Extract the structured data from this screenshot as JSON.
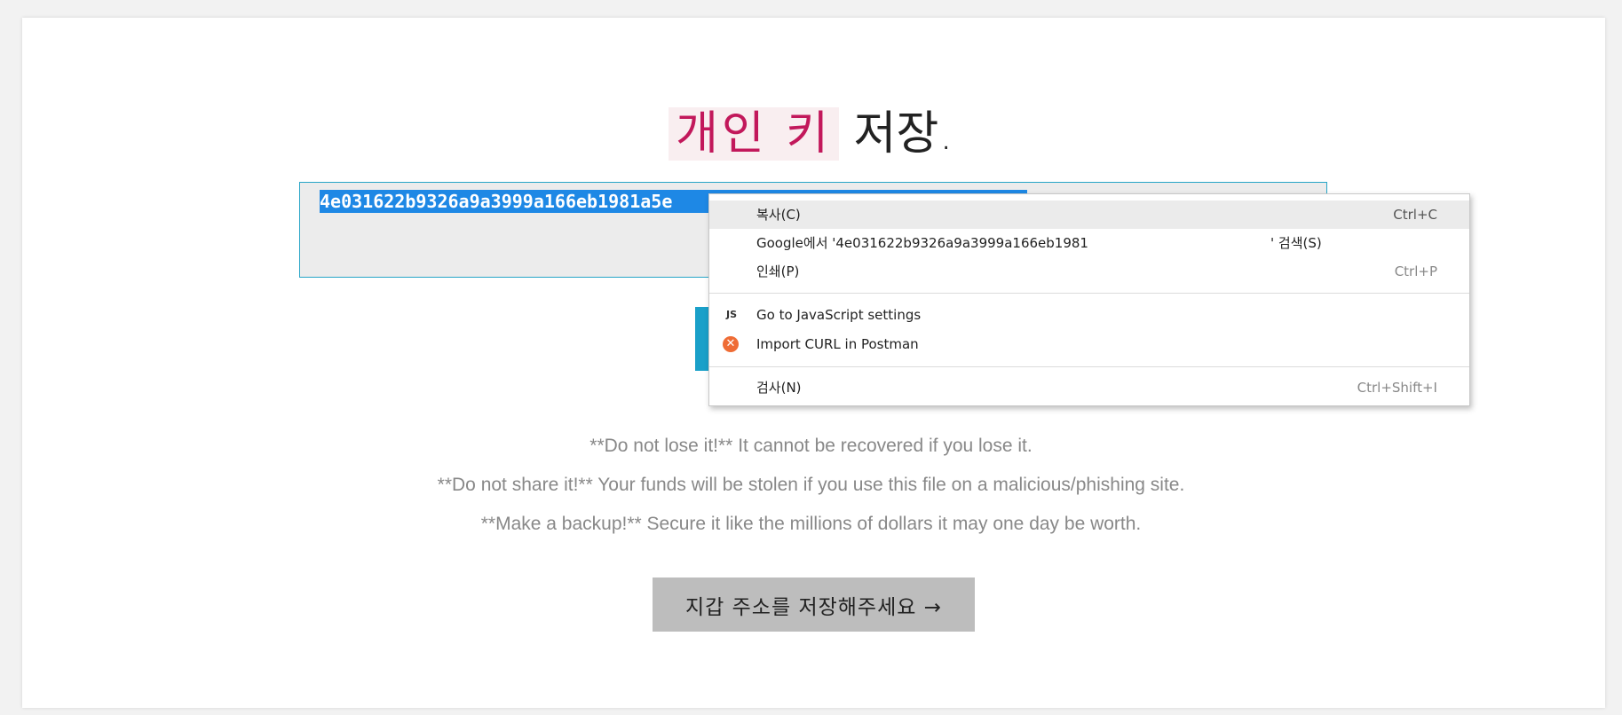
{
  "title": {
    "highlight": "개인 키",
    "rest": " 저장."
  },
  "key_box": {
    "selected_text": "4e031622b9326a9a3999a166eb1981a5e"
  },
  "warnings": [
    "**Do not lose it!** It cannot be recovered if you lose it.",
    "**Do not share it!** Your funds will be stolen if you use this file on a malicious/phishing site.",
    "**Make a backup!** Secure it like the millions of dollars it may one day be worth."
  ],
  "next_button": {
    "label": "지갑 주소를 저장해주세요 →"
  },
  "context_menu": {
    "copy": {
      "label": "복사(C)",
      "shortcut": "Ctrl+C"
    },
    "search_google": {
      "label": "Google에서 '4e031622b9326a9a3999a166eb1981",
      "tail": "' 검색(S)"
    },
    "print": {
      "label": "인쇄(P)",
      "shortcut": "Ctrl+P"
    },
    "js_settings": {
      "label": "Go to JavaScript settings",
      "icon": "js-icon",
      "icon_text": "JS"
    },
    "postman": {
      "label": "Import CURL in Postman",
      "icon": "postman-icon",
      "icon_text": "✕",
      "icon_color": "#ef6c35"
    },
    "inspect": {
      "label": "검사(N)",
      "shortcut": "Ctrl+Shift+I"
    }
  },
  "colors": {
    "accent": "#27a5c7",
    "highlight_text": "#c2185b",
    "selection": "#1e88e5"
  }
}
